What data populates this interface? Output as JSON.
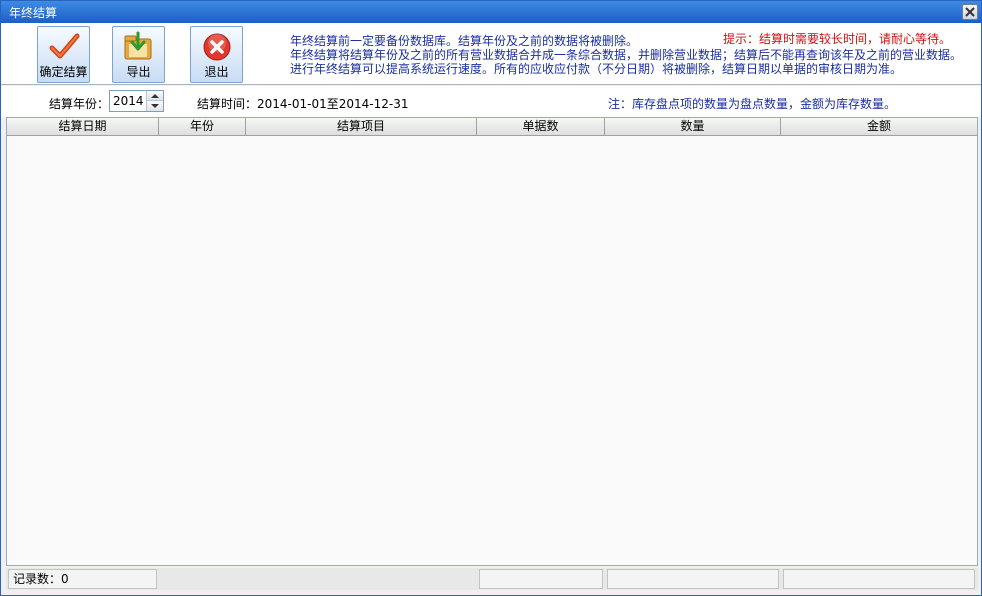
{
  "window": {
    "title": "年终结算"
  },
  "toolbar": {
    "confirm_label": "确定结算",
    "export_label": "导出",
    "exit_label": "退出"
  },
  "info": {
    "line1": "年终结算前一定要备份数据库。结算年份及之前的数据将被删除。",
    "hint": "提示：结算时需要较长时间，请耐心等待。",
    "line2": "年终结算将结算年份及之前的所有营业数据合并成一条综合数据，并删除营业数据；结算后不能再查询该年及之前的营业数据。",
    "line3": "进行年终结算可以提高系统运行速度。所有的应收应付款（不分日期）将被删除，结算日期以单据的审核日期为准。"
  },
  "params": {
    "year_label": "结算年份：",
    "year_value": "2014",
    "time_label": "结算时间：",
    "time_value": "2014-01-01至2014-12-31",
    "note": "注：库存盘点项的数量为盘点数量，金额为库存数量。"
  },
  "grid": {
    "columns": [
      "结算日期",
      "年份",
      "结算项目",
      "单据数",
      "数量",
      "金额"
    ]
  },
  "status": {
    "record_count": "记录数：0"
  },
  "colors": {
    "title_bar": "#1c5fc4",
    "info_text": "#1a2ea0",
    "hint_text": "#d01010"
  }
}
